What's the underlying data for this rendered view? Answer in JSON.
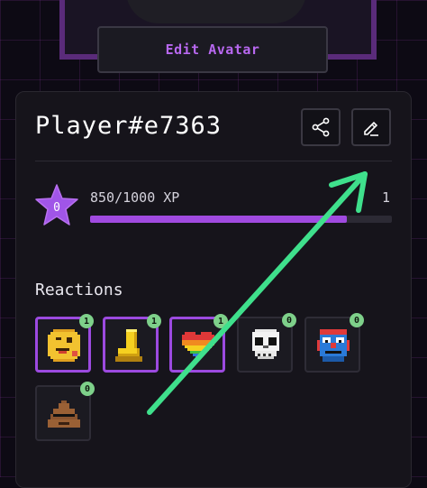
{
  "header": {
    "edit_avatar_label": "Edit Avatar"
  },
  "profile": {
    "player_name": "Player#e7363",
    "share_icon": "share-icon",
    "edit_icon": "pencil-icon"
  },
  "xp": {
    "star_value": "0",
    "progress_text": "850/1000 XP",
    "current": 850,
    "max": 1000,
    "next_level": "1",
    "accent_color": "#a04ae0"
  },
  "reactions": {
    "title": "Reactions",
    "items": [
      {
        "name": "winking-face",
        "count": "1",
        "active": true
      },
      {
        "name": "golden-boot",
        "count": "1",
        "active": true
      },
      {
        "name": "rainbow-heart",
        "count": "1",
        "active": true
      },
      {
        "name": "skull",
        "count": "0",
        "active": false
      },
      {
        "name": "clown-robot",
        "count": "0",
        "active": false
      },
      {
        "name": "poop-with-sunglasses",
        "count": "0",
        "active": false
      }
    ]
  },
  "colors": {
    "badge": "#7ed08a",
    "arrow": "#3fe08c"
  }
}
